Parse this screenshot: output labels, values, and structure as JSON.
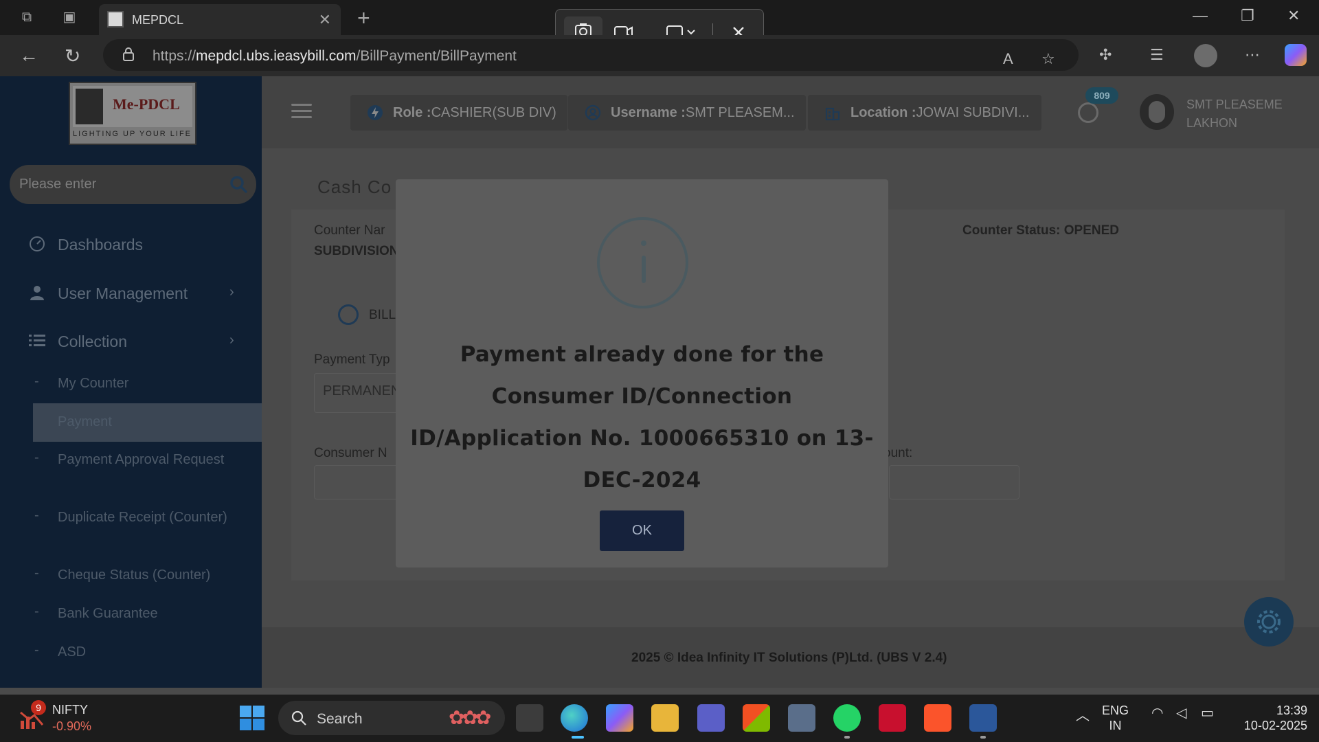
{
  "browser": {
    "tab_title": "MEPDCL",
    "url_prefix": "https://",
    "url_domain": "mepdcl.ubs.ieasybill.com",
    "url_path": "/BillPayment/BillPayment"
  },
  "sidebar": {
    "logo_text": "Me-PDCL",
    "logo_tagline": "LIGHTING UP YOUR LIFE",
    "search_placeholder": "Please enter",
    "menu": [
      {
        "label": "Dashboards"
      },
      {
        "label": "User Management"
      },
      {
        "label": "Collection"
      }
    ],
    "submenu": [
      {
        "label": "My Counter"
      },
      {
        "label": "Payment"
      },
      {
        "label": "Payment Approval Request"
      },
      {
        "label": "Duplicate Receipt (Counter)"
      },
      {
        "label": "Cheque Status (Counter)"
      },
      {
        "label": "Bank Guarantee"
      },
      {
        "label": "ASD"
      }
    ]
  },
  "topbar": {
    "role_label": "Role :",
    "role_value": "CASHIER(SUB DIV)",
    "username_label": "Username :",
    "username_value": "SMT PLEASEM...",
    "location_label": "Location :",
    "location_value": "JOWAI SUBDIVI...",
    "notification_count": "809",
    "user_name": "SMT PLEASEME LAKHON"
  },
  "card": {
    "title": "Cash Co",
    "counter_name_label": "Counter Nar",
    "counter_name_value": "SUBDIVISION",
    "counter_status_label": "Counter Status: ",
    "counter_status_value": "OPENED",
    "radio_label": "BILL",
    "payment_type_label": "Payment Typ",
    "payment_type_value": "PERMANEN",
    "consumer_label": "Consumer N",
    "amount_label": "ount:"
  },
  "footer": {
    "text": "2025 © Idea Infinity IT Solutions (P)Ltd. (UBS V 2.4)"
  },
  "modal": {
    "message": "Payment already done for the Consumer ID/Connection ID/Application No. 1000665310 on 13-DEC-2024",
    "ok_label": "OK"
  },
  "taskbar": {
    "nifty_badge": "9",
    "nifty_label": "NIFTY",
    "nifty_change": "-0.90%",
    "search_label": "Search",
    "lang_top": "ENG",
    "lang_bottom": "IN",
    "time": "13:39",
    "date": "10-02-2025"
  }
}
